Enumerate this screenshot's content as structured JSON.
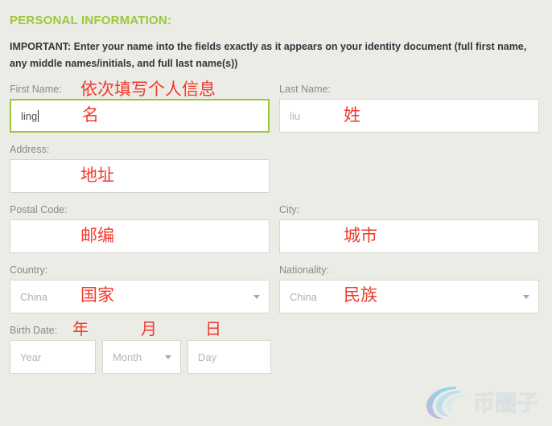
{
  "section": {
    "title": "PERSONAL INFORMATION:",
    "title_color": "#9bc838",
    "important_note": "IMPORTANT: Enter your name into the fields exactly as it appears on your identity document (full first name, any middle names/initials, and full last name(s))"
  },
  "annotation_color": "#f0392b",
  "fields": {
    "first_name": {
      "label": "First Name:",
      "value": "ling",
      "placeholder": "",
      "annotation": "名",
      "header_annotation": "依次填写个人信息",
      "focused": true
    },
    "last_name": {
      "label": "Last Name:",
      "value": "",
      "placeholder": "liu",
      "annotation": "姓",
      "focused": false
    },
    "address": {
      "label": "Address:",
      "value": "",
      "placeholder": "",
      "annotation": "地址",
      "focused": false
    },
    "postal_code": {
      "label": "Postal Code:",
      "value": "",
      "placeholder": "",
      "annotation": "邮编",
      "focused": false
    },
    "city": {
      "label": "City:",
      "value": "",
      "placeholder": "",
      "annotation": "城市",
      "focused": false
    },
    "country": {
      "label": "Country:",
      "selected": "China",
      "annotation": "国家",
      "icon": "chevron-down-icon"
    },
    "nationality": {
      "label": "Nationality:",
      "selected": "China",
      "annotation": "民族",
      "icon": "chevron-down-icon"
    },
    "birth_date": {
      "label": "Birth Date:",
      "year": {
        "placeholder": "Year",
        "value": "",
        "annotation": "年"
      },
      "month": {
        "placeholder": "Month",
        "value": "",
        "annotation": "月",
        "icon": "chevron-down-icon"
      },
      "day": {
        "placeholder": "Day",
        "value": "",
        "annotation": "日"
      }
    }
  },
  "watermark": {
    "text": "币圈子",
    "icon": "swirl-logo-icon"
  }
}
